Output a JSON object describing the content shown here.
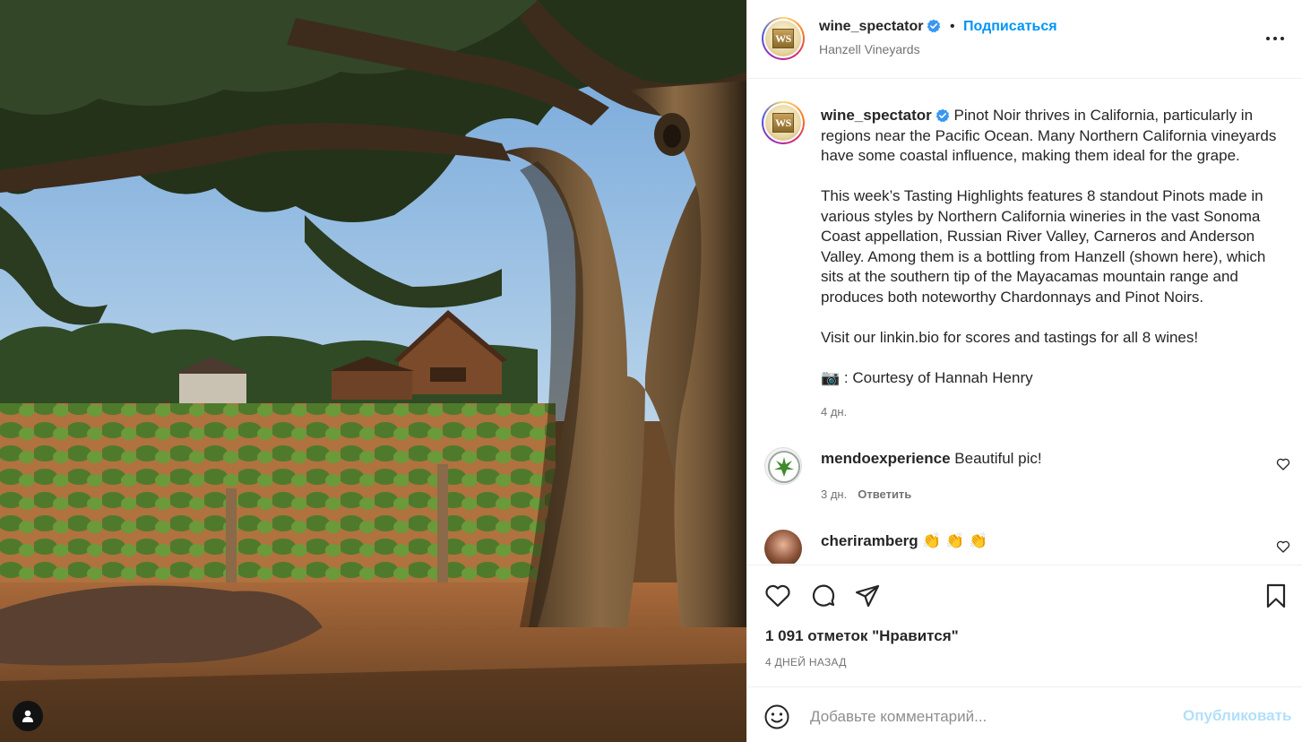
{
  "post": {
    "username": "wine_spectator",
    "follow_label": "Подписаться",
    "separator": "•",
    "location": "Hanzell Vineyards",
    "caption": {
      "paragraph_1": "Pinot Noir thrives in California, particularly in regions near the Pacific Ocean. Many Northern California vineyards have some coastal influence, making them ideal for the grape.",
      "paragraph_2": "This week’s Tasting Highlights features 8 standout Pinots made in various styles by Northern California wineries in the vast Sonoma Coast appellation, Russian River Valley, Carneros and Anderson Valley. Among them is a bottling from Hanzell (shown here), which sits at the southern tip of the Mayacamas mountain range and produces both noteworthy Chardonnays and Pinot Noirs.",
      "paragraph_3": "Visit our linkin.bio for scores and tastings for all 8 wines!",
      "credit_emoji": "📷",
      "credit": ": Courtesy of Hannah Henry",
      "time": "4 дн."
    },
    "comments": [
      {
        "username": "mendoexperience",
        "text": "Beautiful pic!",
        "time": "3 дн.",
        "reply_label": "Ответить"
      },
      {
        "username": "cheriramberg",
        "text": "👏 👏 👏"
      }
    ],
    "likes": "1 091 отметок \"Нравится\"",
    "date": "4 ДНЕЙ НАЗАД",
    "comment_placeholder": "Добавьте комментарий...",
    "publish_label": "Опубликовать"
  },
  "colors": {
    "link_blue": "#0095f6",
    "publish_disabled": "#b2dffc",
    "muted": "#737373",
    "verified": "#3897f0"
  },
  "icons": [
    "verified-badge-icon",
    "more-options-icon",
    "heart-icon",
    "comment-icon",
    "share-icon",
    "bookmark-icon",
    "emoji-icon",
    "tag-user-icon"
  ]
}
